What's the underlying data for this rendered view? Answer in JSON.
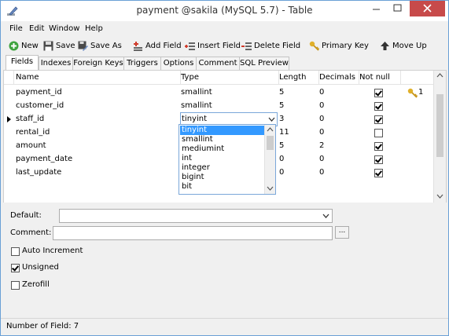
{
  "window": {
    "title": "payment @sakila (MySQL 5.7) - Table"
  },
  "menu": {
    "file": "File",
    "edit": "Edit",
    "window": "Window",
    "help": "Help"
  },
  "toolbar": {
    "new": "New",
    "save": "Save",
    "save_as": "Save As",
    "add_field": "Add Field",
    "insert_field": "Insert Field",
    "delete_field": "Delete Field",
    "primary_key": "Primary Key",
    "move_up": "Move Up"
  },
  "tabs": [
    "Fields",
    "Indexes",
    "Foreign Keys",
    "Triggers",
    "Options",
    "Comment",
    "SQL Preview"
  ],
  "grid": {
    "headers": {
      "name": "Name",
      "type": "Type",
      "length": "Length",
      "decimals": "Decimals",
      "not_null": "Not null"
    },
    "rows": [
      {
        "name": "payment_id",
        "type": "smallint",
        "length": "5",
        "decimals": "0",
        "not_null": true,
        "key": "1"
      },
      {
        "name": "customer_id",
        "type": "smallint",
        "length": "5",
        "decimals": "0",
        "not_null": true,
        "key": ""
      },
      {
        "name": "staff_id",
        "type": "tinyint",
        "length": "3",
        "decimals": "0",
        "not_null": true,
        "key": ""
      },
      {
        "name": "rental_id",
        "type": "",
        "length": "11",
        "decimals": "0",
        "not_null": false,
        "key": ""
      },
      {
        "name": "amount",
        "type": "",
        "length": "5",
        "decimals": "2",
        "not_null": true,
        "key": ""
      },
      {
        "name": "payment_date",
        "type": "",
        "length": "0",
        "decimals": "0",
        "not_null": true,
        "key": ""
      },
      {
        "name": "last_update",
        "type": "",
        "length": "0",
        "decimals": "0",
        "not_null": true,
        "key": ""
      }
    ]
  },
  "type_dropdown": {
    "options": [
      "tinyint",
      "smallint",
      "mediumint",
      "int",
      "integer",
      "bigint",
      "bit"
    ],
    "selected": "tinyint"
  },
  "properties": {
    "default_label": "Default:",
    "comment_label": "Comment:",
    "ellipsis": "...",
    "auto_increment": "Auto Increment",
    "auto_increment_checked": false,
    "unsigned": "Unsigned",
    "unsigned_checked": true,
    "zerofill": "Zerofill",
    "zerofill_checked": false
  },
  "status": {
    "text": "Number of Field: 7"
  },
  "colors": {
    "title_text": "#333333",
    "close_button": "#c74a4a",
    "selection": "#3399ff",
    "key_icon": "#e0b02a"
  },
  "icons": {
    "app": "pencil-edit-icon",
    "key": "key-icon",
    "row_indicator": "row-pointer-icon"
  }
}
